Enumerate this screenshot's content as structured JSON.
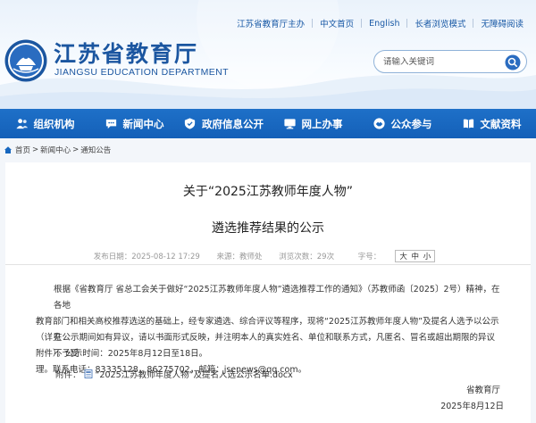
{
  "top_links": [
    "江苏省教育厅主办",
    "中文首页",
    "English",
    "长者浏览模式",
    "无障碍阅读"
  ],
  "logo": {
    "cn": "江苏省教育厅",
    "en": "JIANGSU EDUCATION DEPARTMENT"
  },
  "search": {
    "placeholder": "请输入关键词"
  },
  "nav": [
    {
      "label": "组织机构",
      "icon": "people-icon"
    },
    {
      "label": "新闻中心",
      "icon": "chat-icon"
    },
    {
      "label": "政府信息公开",
      "icon": "shield-icon"
    },
    {
      "label": "网上办事",
      "icon": "monitor-icon"
    },
    {
      "label": "公众参与",
      "icon": "handshake-icon"
    },
    {
      "label": "文献资料",
      "icon": "book-icon"
    }
  ],
  "breadcrumb": {
    "home": "首页",
    "level1": "新闻中心",
    "level2": "通知公告"
  },
  "article": {
    "title_line1": "关于“2025江苏教师年度人物”",
    "title_line2": "遴选推荐结果的公示",
    "published": "发布日期：2025-08-12 17:29",
    "source": "来源：教师处",
    "views": "浏览次数：29次",
    "font_label": "字号：",
    "font_large": "大",
    "font_medium": "中",
    "font_small": "小",
    "para1_line1": "根据《省教育厅 省总工会关于做好“2025江苏教师年度人物”遴选推荐工作的通知》（苏教师函〔2025〕2号）精神，在各地",
    "para1_line2": "教育部门和相关高校推荐选送的基础上，经专家遴选、综合评议等程序，现将“2025江苏教师年度人物”及提名人选予以公示（详见",
    "para1_line3": "附件）。公示时间：2025年8月12日至18日。",
    "para2_line1": "在公示期间如有异议，请以书面形式反映，并注明本人的真实姓名、单位和联系方式，凡匿名、冒名或超出期限的异议不予受",
    "para2_line2": "理。联系电话：83335128，86275702，邮箱：jsenews@qq.com。",
    "attachment_label": "附件：",
    "attachment_file": "“2025江苏教师年度人物”及提名人选公示名单.docx",
    "signer": "省教育厅",
    "sign_date": "2025年8月12日"
  },
  "colors": {
    "brand_blue": "#1b56a0",
    "nav_blue": "#1767bf"
  }
}
